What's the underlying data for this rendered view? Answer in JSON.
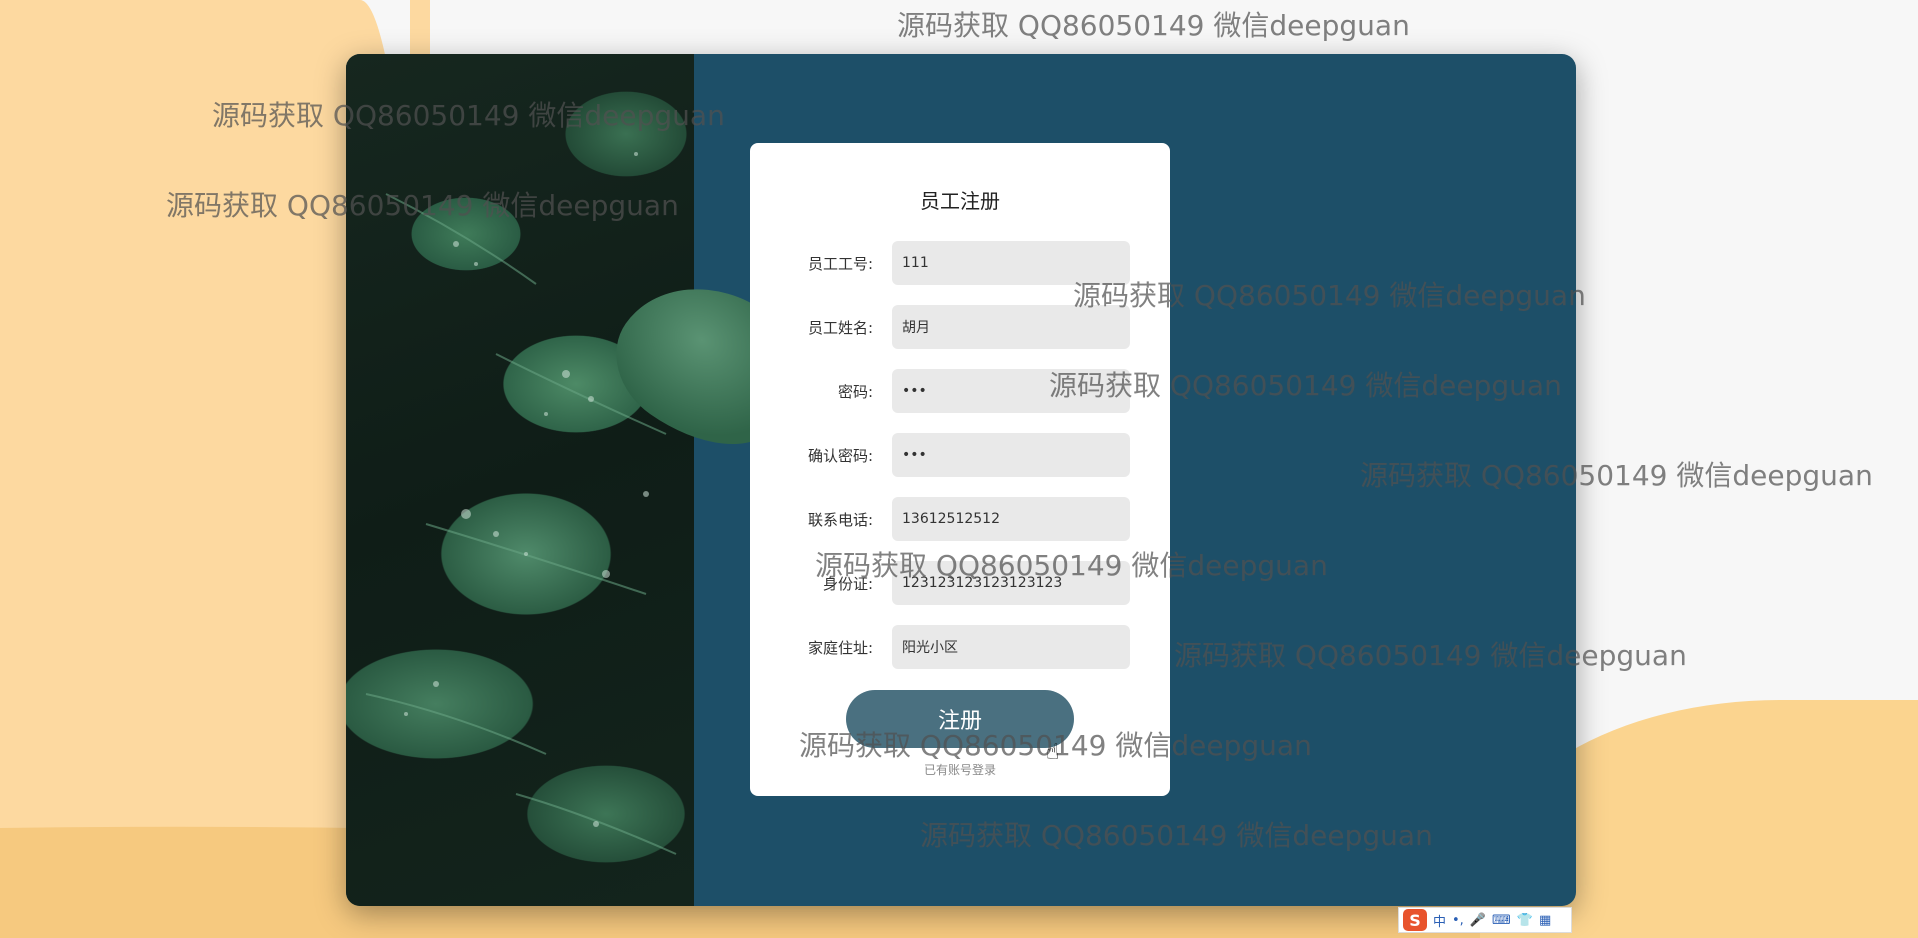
{
  "form": {
    "title": "员工注册",
    "fields": [
      {
        "label": "员工工号:",
        "value": "111",
        "type": "text"
      },
      {
        "label": "员工姓名:",
        "value": "胡月",
        "type": "text"
      },
      {
        "label": "密码:",
        "value": "•••",
        "type": "password"
      },
      {
        "label": "确认密码:",
        "value": "•••",
        "type": "password"
      },
      {
        "label": "联系电话:",
        "value": "13612512512",
        "type": "text"
      },
      {
        "label": "身份证:",
        "value": "123123123123123123",
        "type": "text"
      },
      {
        "label": "家庭住址:",
        "value": "阳光小区",
        "type": "text"
      }
    ],
    "submit_label": "注册",
    "login_link": "已有账号登录"
  },
  "watermark": {
    "text": "源码获取 QQ86050149 微信deepguan"
  },
  "ime": {
    "logo": "S",
    "items": [
      "中",
      "•,",
      "🎤",
      "⌨",
      "👕",
      "▦"
    ]
  },
  "colors": {
    "panel": "#1d4f68",
    "button": "#4a7080",
    "input_bg": "#e9e9e9",
    "peach": "#fdd9a0"
  }
}
